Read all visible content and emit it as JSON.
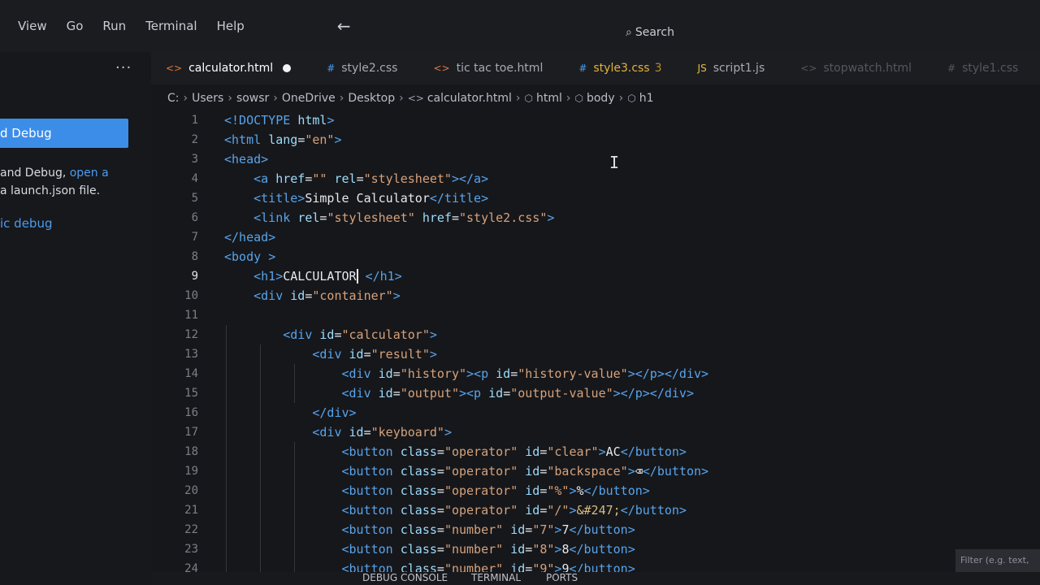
{
  "menubar": {
    "items": [
      "View",
      "Go",
      "Run",
      "Terminal",
      "Help"
    ],
    "back_icon": "arrow-left-icon",
    "search_label": "Search"
  },
  "sidebar": {
    "more": "...",
    "run_debug_button": "d Debug",
    "text_1": " and Debug, ",
    "link_1": "open a",
    "text_2": "a launch.json file.",
    "link_2": "ic debug"
  },
  "tabs": [
    {
      "label": "calculator.html",
      "icon": "html-file-icon",
      "active": true,
      "modified": true
    },
    {
      "label": "style2.css",
      "icon": "css-file-icon"
    },
    {
      "label": "tic tac toe.html",
      "icon": "html-file-icon"
    },
    {
      "label": "style3.css",
      "badge": "3",
      "icon": "css-file-icon",
      "warning": true
    },
    {
      "label": "script1.js",
      "icon": "js-file-icon"
    },
    {
      "label": "stopwatch.html",
      "icon": "html-file-icon",
      "faded": true
    },
    {
      "label": "style1.css",
      "icon": "css-file-icon",
      "faded": true
    }
  ],
  "breadcrumb": [
    "C:",
    "Users",
    "sowsr",
    "OneDrive",
    "Desktop",
    "calculator.html",
    "html",
    "body",
    "h1"
  ],
  "code": {
    "active_line": 9,
    "lines": [
      {
        "n": "1",
        "parts": [
          [
            "tag",
            "<!DOCTYPE "
          ],
          [
            "attr",
            "html"
          ],
          [
            "tag",
            ">"
          ]
        ]
      },
      {
        "n": "2",
        "parts": [
          [
            "tag",
            "<html "
          ],
          [
            "attr",
            "lang"
          ],
          [
            "txt",
            "="
          ],
          [
            "str",
            "\"en\""
          ],
          [
            "tag",
            ">"
          ]
        ]
      },
      {
        "n": "3",
        "parts": [
          [
            "tag",
            "<head>"
          ]
        ]
      },
      {
        "n": "4",
        "parts": [
          [
            "txt",
            "    "
          ],
          [
            "tag",
            "<a "
          ],
          [
            "attr",
            "href"
          ],
          [
            "txt",
            "="
          ],
          [
            "str",
            "\"\""
          ],
          [
            "txt",
            " "
          ],
          [
            "attr",
            "rel"
          ],
          [
            "txt",
            "="
          ],
          [
            "str",
            "\"stylesheet\""
          ],
          [
            "tag",
            "></a>"
          ]
        ]
      },
      {
        "n": "5",
        "parts": [
          [
            "txt",
            "    "
          ],
          [
            "tag",
            "<title>"
          ],
          [
            "txt",
            "Simple Calculator"
          ],
          [
            "tag",
            "</title>"
          ]
        ]
      },
      {
        "n": "6",
        "parts": [
          [
            "txt",
            "    "
          ],
          [
            "tag",
            "<link "
          ],
          [
            "attr",
            "rel"
          ],
          [
            "txt",
            "="
          ],
          [
            "str",
            "\"stylesheet\""
          ],
          [
            "txt",
            " "
          ],
          [
            "attr",
            "href"
          ],
          [
            "txt",
            "="
          ],
          [
            "str",
            "\"style2.css\""
          ],
          [
            "tag",
            ">"
          ]
        ]
      },
      {
        "n": "7",
        "parts": [
          [
            "tag",
            "</head>"
          ]
        ]
      },
      {
        "n": "8",
        "parts": [
          [
            "tag",
            "<body "
          ],
          [
            "tag",
            ">"
          ]
        ]
      },
      {
        "n": "9",
        "parts": [
          [
            "txt",
            "    "
          ],
          [
            "tag",
            "<h1>"
          ],
          [
            "txt",
            "CALCULATOR"
          ],
          [
            "cursor",
            ""
          ],
          [
            "txt",
            " "
          ],
          [
            "tag",
            "</h1>"
          ]
        ]
      },
      {
        "n": "10",
        "parts": [
          [
            "txt",
            "    "
          ],
          [
            "tag",
            "<div "
          ],
          [
            "attr",
            "id"
          ],
          [
            "txt",
            "="
          ],
          [
            "str",
            "\"container\""
          ],
          [
            "tag",
            ">"
          ]
        ]
      },
      {
        "n": "11",
        "parts": [
          [
            "txt",
            ""
          ]
        ]
      },
      {
        "n": "12",
        "parts": [
          [
            "txt",
            "        "
          ],
          [
            "tag",
            "<div "
          ],
          [
            "attr",
            "id"
          ],
          [
            "txt",
            "="
          ],
          [
            "str",
            "\"calculator\""
          ],
          [
            "tag",
            ">"
          ]
        ]
      },
      {
        "n": "13",
        "parts": [
          [
            "txt",
            "            "
          ],
          [
            "tag",
            "<div "
          ],
          [
            "attr",
            "id"
          ],
          [
            "txt",
            "="
          ],
          [
            "str",
            "\"result\""
          ],
          [
            "tag",
            ">"
          ]
        ]
      },
      {
        "n": "14",
        "parts": [
          [
            "txt",
            "                "
          ],
          [
            "tag",
            "<div "
          ],
          [
            "attr",
            "id"
          ],
          [
            "txt",
            "="
          ],
          [
            "str",
            "\"history\""
          ],
          [
            "tag",
            "><p "
          ],
          [
            "attr",
            "id"
          ],
          [
            "txt",
            "="
          ],
          [
            "str",
            "\"history-value\""
          ],
          [
            "tag",
            "></p></div>"
          ]
        ]
      },
      {
        "n": "15",
        "parts": [
          [
            "txt",
            "                "
          ],
          [
            "tag",
            "<div "
          ],
          [
            "attr",
            "id"
          ],
          [
            "txt",
            "="
          ],
          [
            "str",
            "\"output\""
          ],
          [
            "tag",
            "><p "
          ],
          [
            "attr",
            "id"
          ],
          [
            "txt",
            "="
          ],
          [
            "str",
            "\"output-value\""
          ],
          [
            "tag",
            "></p></div>"
          ]
        ]
      },
      {
        "n": "16",
        "parts": [
          [
            "txt",
            "            "
          ],
          [
            "tag",
            "</div>"
          ]
        ]
      },
      {
        "n": "17",
        "parts": [
          [
            "txt",
            "            "
          ],
          [
            "tag",
            "<div "
          ],
          [
            "attr",
            "id"
          ],
          [
            "txt",
            "="
          ],
          [
            "str",
            "\"keyboard\""
          ],
          [
            "tag",
            ">"
          ]
        ]
      },
      {
        "n": "18",
        "parts": [
          [
            "txt",
            "                "
          ],
          [
            "tag",
            "<button "
          ],
          [
            "attr",
            "class"
          ],
          [
            "txt",
            "="
          ],
          [
            "str",
            "\"operator\""
          ],
          [
            "txt",
            " "
          ],
          [
            "attr",
            "id"
          ],
          [
            "txt",
            "="
          ],
          [
            "str",
            "\"clear\""
          ],
          [
            "tag",
            ">"
          ],
          [
            "txt",
            "AC"
          ],
          [
            "tag",
            "</button>"
          ]
        ]
      },
      {
        "n": "19",
        "parts": [
          [
            "txt",
            "                "
          ],
          [
            "tag",
            "<button "
          ],
          [
            "attr",
            "class"
          ],
          [
            "txt",
            "="
          ],
          [
            "str",
            "\"operator\""
          ],
          [
            "txt",
            " "
          ],
          [
            "attr",
            "id"
          ],
          [
            "txt",
            "="
          ],
          [
            "str",
            "\"backspace\""
          ],
          [
            "tag",
            ">"
          ],
          [
            "txt",
            "⌫"
          ],
          [
            "tag",
            "</button>"
          ]
        ]
      },
      {
        "n": "20",
        "parts": [
          [
            "txt",
            "                "
          ],
          [
            "tag",
            "<button "
          ],
          [
            "attr",
            "class"
          ],
          [
            "txt",
            "="
          ],
          [
            "str",
            "\"operator\""
          ],
          [
            "txt",
            " "
          ],
          [
            "attr",
            "id"
          ],
          [
            "txt",
            "="
          ],
          [
            "str",
            "\"%\""
          ],
          [
            "tag",
            ">"
          ],
          [
            "txt",
            "%"
          ],
          [
            "tag",
            "</button>"
          ]
        ]
      },
      {
        "n": "21",
        "parts": [
          [
            "txt",
            "                "
          ],
          [
            "tag",
            "<button "
          ],
          [
            "attr",
            "class"
          ],
          [
            "txt",
            "="
          ],
          [
            "str",
            "\"operator\""
          ],
          [
            "txt",
            " "
          ],
          [
            "attr",
            "id"
          ],
          [
            "txt",
            "="
          ],
          [
            "str",
            "\"/\""
          ],
          [
            "tag",
            ">"
          ],
          [
            "ent",
            "&#247;"
          ],
          [
            "tag",
            "</button>"
          ]
        ]
      },
      {
        "n": "22",
        "parts": [
          [
            "txt",
            "                "
          ],
          [
            "tag",
            "<button "
          ],
          [
            "attr",
            "class"
          ],
          [
            "txt",
            "="
          ],
          [
            "str",
            "\"number\""
          ],
          [
            "txt",
            " "
          ],
          [
            "attr",
            "id"
          ],
          [
            "txt",
            "="
          ],
          [
            "str",
            "\"7\""
          ],
          [
            "tag",
            ">"
          ],
          [
            "txt",
            "7"
          ],
          [
            "tag",
            "</button>"
          ]
        ]
      },
      {
        "n": "23",
        "parts": [
          [
            "txt",
            "                "
          ],
          [
            "tag",
            "<button "
          ],
          [
            "attr",
            "class"
          ],
          [
            "txt",
            "="
          ],
          [
            "str",
            "\"number\""
          ],
          [
            "txt",
            " "
          ],
          [
            "attr",
            "id"
          ],
          [
            "txt",
            "="
          ],
          [
            "str",
            "\"8\""
          ],
          [
            "tag",
            ">"
          ],
          [
            "txt",
            "8"
          ],
          [
            "tag",
            "</button>"
          ]
        ]
      },
      {
        "n": "24",
        "parts": [
          [
            "txt",
            "                "
          ],
          [
            "tag",
            "<button "
          ],
          [
            "attr",
            "class"
          ],
          [
            "txt",
            "="
          ],
          [
            "str",
            "\"number\""
          ],
          [
            "txt",
            " "
          ],
          [
            "attr",
            "id"
          ],
          [
            "txt",
            "="
          ],
          [
            "str",
            "\"9\""
          ],
          [
            "tag",
            ">"
          ],
          [
            "txt",
            "9"
          ],
          [
            "tag",
            "</button>"
          ]
        ]
      }
    ]
  },
  "panel": {
    "tabs": [
      "DEBUG CONSOLE",
      "TERMINAL",
      "PORTS"
    ],
    "filter_placeholder": "Filter (e.g. text, !exclude)"
  }
}
